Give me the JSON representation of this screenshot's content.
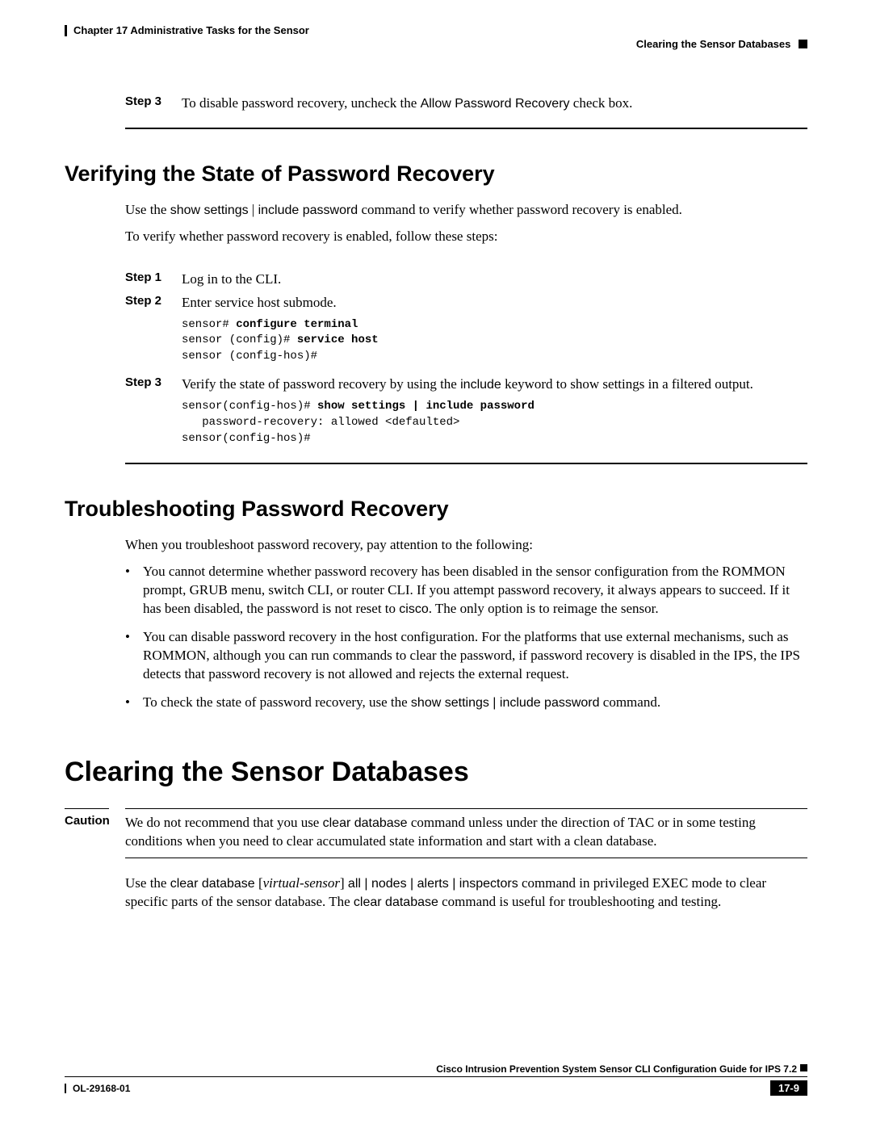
{
  "header": {
    "chapter": "Chapter 17    Administrative Tasks for the Sensor",
    "section": "Clearing the Sensor Databases"
  },
  "step3_top": {
    "label": "Step 3",
    "text_a": "To disable password recovery, uncheck the ",
    "text_b": "Allow Password Recovery",
    "text_c": " check box."
  },
  "section1": {
    "title": "Verifying the State of Password Recovery",
    "intro_a": "Use the ",
    "intro_cmd1": "show settings",
    "intro_mid": " | ",
    "intro_cmd2": "include password",
    "intro_b": " command to verify whether password recovery is enabled.",
    "intro2": "To verify whether password recovery is enabled, follow these steps:",
    "step1": {
      "label": "Step 1",
      "text": "Log in to the CLI."
    },
    "step2": {
      "label": "Step 2",
      "text": "Enter service host submode."
    },
    "code1_l1a": "sensor# ",
    "code1_l1b": "configure terminal",
    "code1_l2a": "sensor (config)# ",
    "code1_l2b": "service host",
    "code1_l3": "sensor (config-hos)#",
    "step3": {
      "label": "Step 3",
      "text_a": "Verify the state of password recovery by using the ",
      "text_b": "include",
      "text_c": " keyword to show settings in a filtered output."
    },
    "code2_l1a": "sensor(config-hos)# ",
    "code2_l1b": "show settings | include password",
    "code2_l2": "   password-recovery: allowed <defaulted>",
    "code2_l3": "sensor(config-hos)#"
  },
  "section2": {
    "title": "Troubleshooting Password Recovery",
    "intro": "When you troubleshoot password recovery, pay attention to the following:",
    "b1_a": "You cannot determine whether password recovery has been disabled in the sensor configuration from the ROMMON prompt, GRUB menu, switch CLI, or router CLI. If you attempt password recovery, it always appears to succeed. If it has been disabled, the password is not reset to ",
    "b1_b": "cisco",
    "b1_c": ". The only option is to reimage the sensor.",
    "b2": "You can disable password recovery in the host configuration. For the platforms that use external mechanisms, such as ROMMON, although you can run commands to clear the password, if password recovery is disabled in the IPS, the IPS detects that password recovery is not allowed and rejects the external request.",
    "b3_a": "To check the state of password recovery, use the ",
    "b3_b": "show settings | include password",
    "b3_c": " command."
  },
  "section3": {
    "title": "Clearing the Sensor Databases",
    "caution_label": "Caution",
    "caution_a": "We do not recommend that you use ",
    "caution_b": "clear database",
    "caution_c": " command unless under the direction of TAC or in some testing conditions when you need to clear accumulated state information and start with a clean database.",
    "para_a": "Use the ",
    "para_b": "clear database",
    "para_c": " [",
    "para_d": "virtual-sensor",
    "para_e": "] ",
    "para_f": "all | nodes | alerts | inspectors",
    "para_g": " command in privileged EXEC mode to clear specific parts of the sensor database. The ",
    "para_h": "clear database",
    "para_i": " command is useful for troubleshooting and testing."
  },
  "footer": {
    "title": "Cisco Intrusion Prevention System Sensor CLI Configuration Guide for IPS 7.2",
    "doc": "OL-29168-01",
    "page": "17-9"
  }
}
